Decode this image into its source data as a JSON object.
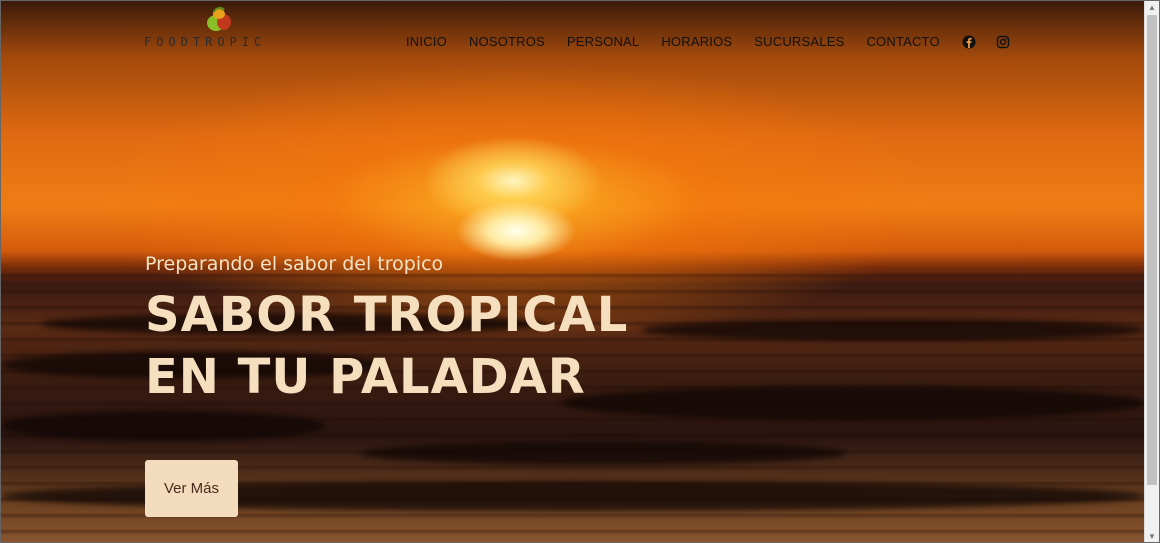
{
  "brand": {
    "name": "FOODTROPIC"
  },
  "nav": {
    "items": [
      {
        "label": "INICIO"
      },
      {
        "label": "NOSOTROS"
      },
      {
        "label": "PERSONAL"
      },
      {
        "label": "HORARIOS"
      },
      {
        "label": "SUCURSALES"
      },
      {
        "label": "CONTACTO"
      }
    ],
    "social": [
      "facebook-icon",
      "instagram-icon"
    ]
  },
  "hero": {
    "tagline": "Preparando el sabor del tropico",
    "headline_line1": "SABOR TROPICAL",
    "headline_line2": "EN TU PALADAR",
    "cta_label": "Ver Más"
  },
  "colors": {
    "hero_text": "#f5dfbf",
    "button_bg": "#f2dcbd",
    "button_text": "#4a2a1a",
    "nav_text": "#111111"
  }
}
